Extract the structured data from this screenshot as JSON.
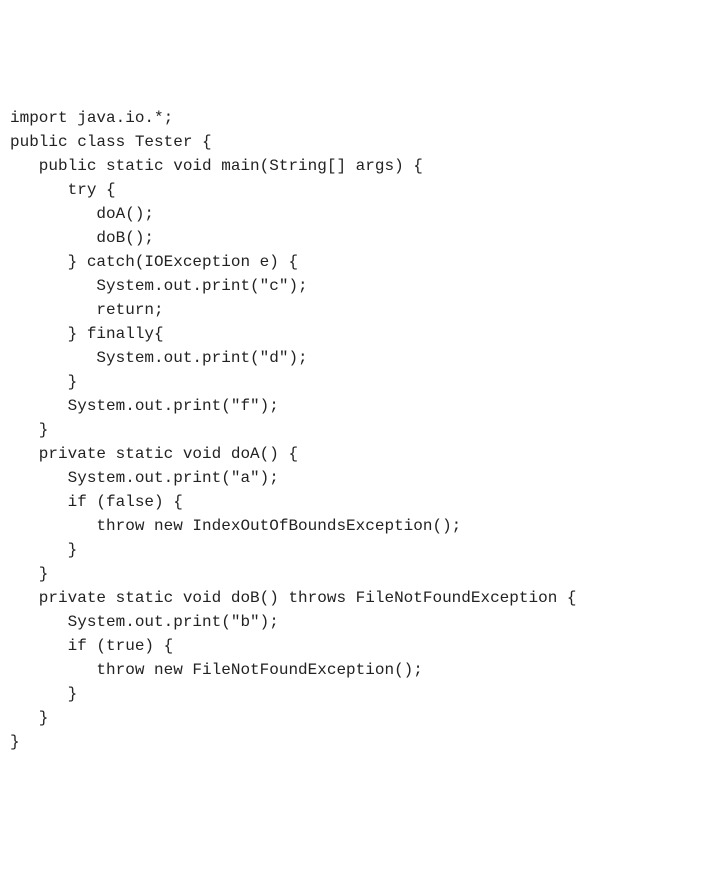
{
  "code": {
    "lines": [
      "import java.io.*;",
      "public class Tester {",
      "   public static void main(String[] args) {",
      "      try {",
      "         doA();",
      "         doB();",
      "      } catch(IOException e) {",
      "         System.out.print(\"c\");",
      "         return;",
      "      } finally{",
      "         System.out.print(\"d\");",
      "      }",
      "      System.out.print(\"f\");",
      "   }",
      "   private static void doA() {",
      "      System.out.print(\"a\");",
      "      if (false) {",
      "         throw new IndexOutOfBoundsException();",
      "      }",
      "   }",
      "   private static void doB() throws FileNotFoundException {",
      "      System.out.print(\"b\");",
      "      if (true) {",
      "         throw new FileNotFoundException();",
      "      }",
      "   }",
      "}"
    ]
  }
}
